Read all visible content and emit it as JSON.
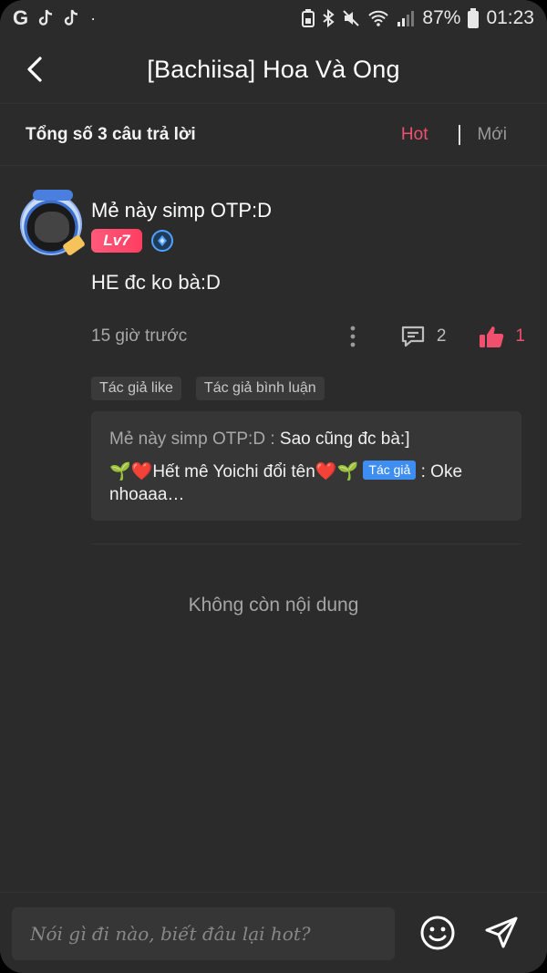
{
  "status_bar": {
    "battery": "87%",
    "time": "01:23",
    "dot": "·"
  },
  "header": {
    "title": "[Bachiisa] Hoa Và Ong"
  },
  "summary": {
    "total": "Tổng số 3 câu trả lời",
    "sort_hot": "Hot",
    "sort_new": "Mới"
  },
  "comment": {
    "username": "Mẻ này simp OTP:D",
    "level": "Lv7",
    "text": "HE đc ko bà:D",
    "time": "15 giờ trước",
    "reply_count": "2",
    "like_count": "1",
    "tags": [
      "Tác giả like",
      "Tác giả bình luận"
    ],
    "replies": [
      {
        "user": "Mẻ này simp OTP:D :",
        "text": "Sao cũng đc bà:]"
      },
      {
        "user": "🌱❤️Hết mê Yoichi đổi tên❤️🌱",
        "chip": "Tác giả",
        "text": ": Oke nhoaaa…"
      }
    ]
  },
  "end_text": "Không còn nội dung",
  "composer": {
    "placeholder": "Nói gì đi nào, biết đâu lại hot?"
  },
  "colors": {
    "accent": "#f0506e",
    "background": "#2b2b2b",
    "author_chip": "#3d8ef0"
  }
}
